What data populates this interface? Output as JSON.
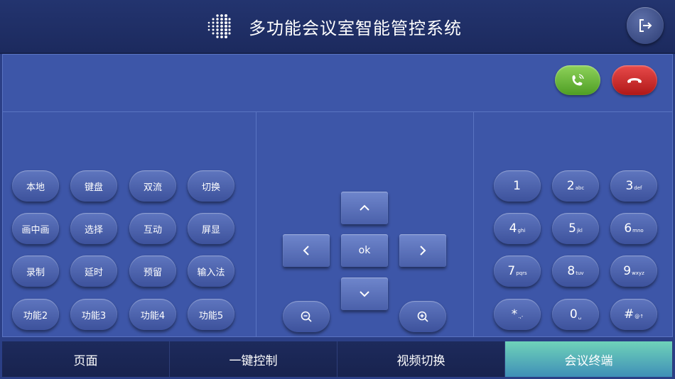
{
  "header": {
    "title": "多功能会议室智能管控系统",
    "logo_icon": "dot-grid-logo",
    "exit_icon": "logout-icon"
  },
  "call": {
    "answer_icon": "phone-answer-icon",
    "hangup_icon": "phone-hangup-icon",
    "answer_color": "#6ab83a",
    "hangup_color": "#d42a2a"
  },
  "functions": [
    "本地",
    "键盘",
    "双流",
    "切换",
    "画中画",
    "选择",
    "互动",
    "屏显",
    "录制",
    "延时",
    "预留",
    "输入法",
    "功能2",
    "功能3",
    "功能4",
    "功能5"
  ],
  "nav": {
    "up_icon": "chevron-up-icon",
    "down_icon": "chevron-down-icon",
    "left_icon": "chevron-left-icon",
    "right_icon": "chevron-right-icon",
    "ok_label": "ok",
    "zoom_out_icon": "zoom-out-icon",
    "zoom_in_icon": "zoom-in-icon"
  },
  "keypad": [
    {
      "main": "1",
      "sub": ""
    },
    {
      "main": "2",
      "sub": "abc"
    },
    {
      "main": "3",
      "sub": "def"
    },
    {
      "main": "4",
      "sub": "ghi"
    },
    {
      "main": "5",
      "sub": "jkl"
    },
    {
      "main": "6",
      "sub": "mno"
    },
    {
      "main": "7",
      "sub": "pqrs"
    },
    {
      "main": "8",
      "sub": "tuv"
    },
    {
      "main": "9",
      "sub": "wxyz"
    },
    {
      "main": "*",
      "sub": ".,-"
    },
    {
      "main": "0",
      "sub": "␣"
    },
    {
      "main": "#",
      "sub": "@↑"
    }
  ],
  "tabs": [
    "页面",
    "一键控制",
    "视频切换",
    "会议终端"
  ],
  "active_tab": "会议终端",
  "colors": {
    "accent_tab": "#4fb3b8",
    "background": "#3d56a8"
  }
}
